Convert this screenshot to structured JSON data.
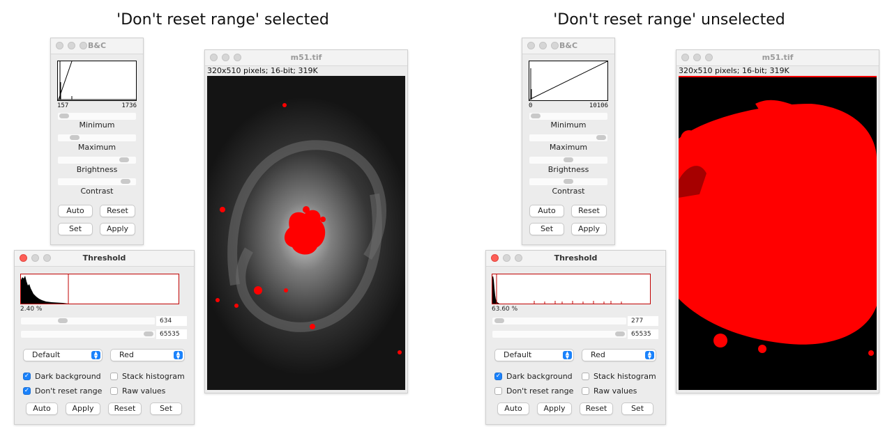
{
  "panels": [
    {
      "caption": "'Don't reset range' selected",
      "bc": {
        "title": "B&C",
        "range_min": "157",
        "range_max": "1736",
        "slider_labels": [
          "Minimum",
          "Maximum",
          "Brightness",
          "Contrast"
        ],
        "buttons": [
          "Auto",
          "Reset",
          "Set",
          "Apply"
        ]
      },
      "threshold": {
        "title": "Threshold",
        "percent": "2.40 %",
        "lower_value": "634",
        "upper_value": "65535",
        "method": "Default",
        "display": "Red",
        "options": [
          {
            "label": "Dark background",
            "checked": true
          },
          {
            "label": "Stack histogram",
            "checked": false
          },
          {
            "label": "Don't reset range",
            "checked": true
          },
          {
            "label": "Raw values",
            "checked": false
          }
        ],
        "buttons": [
          "Auto",
          "Apply",
          "Reset",
          "Set"
        ]
      },
      "image": {
        "title": "m51.tif",
        "info": "320x510 pixels; 16-bit; 319K"
      }
    },
    {
      "caption": "'Don't reset range' unselected",
      "bc": {
        "title": "B&C",
        "range_min": "0",
        "range_max": "10106",
        "slider_labels": [
          "Minimum",
          "Maximum",
          "Brightness",
          "Contrast"
        ],
        "buttons": [
          "Auto",
          "Reset",
          "Set",
          "Apply"
        ]
      },
      "threshold": {
        "title": "Threshold",
        "percent": "63.60 %",
        "lower_value": "277",
        "upper_value": "65535",
        "method": "Default",
        "display": "Red",
        "options": [
          {
            "label": "Dark background",
            "checked": true
          },
          {
            "label": "Stack histogram",
            "checked": false
          },
          {
            "label": "Don't reset range",
            "checked": false
          },
          {
            "label": "Raw values",
            "checked": false
          }
        ],
        "buttons": [
          "Auto",
          "Apply",
          "Reset",
          "Set"
        ]
      },
      "image": {
        "title": "m51.tif",
        "info": "320x510 pixels; 16-bit; 319K"
      }
    }
  ]
}
